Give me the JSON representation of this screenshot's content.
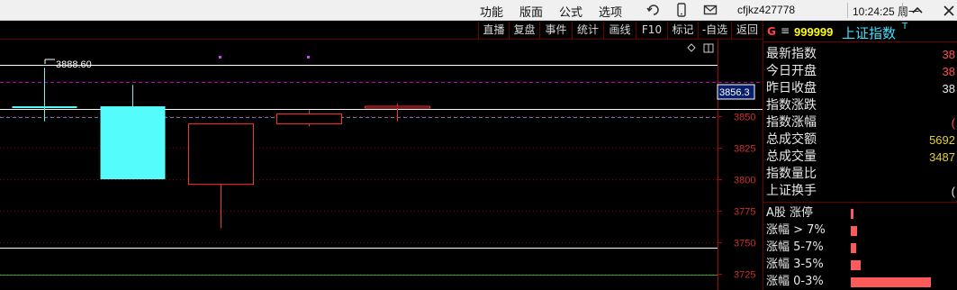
{
  "titlebar": {
    "menus": [
      "功能",
      "版面",
      "公式",
      "选项"
    ],
    "account": "cfjkz427778",
    "clock": "10:24:25 周一"
  },
  "toolbar": {
    "buttons": [
      "直播",
      "复盘",
      "事件",
      "统计",
      "画线",
      "F10",
      "标记",
      "-自选",
      "返回"
    ]
  },
  "chart": {
    "peak_label": "3888.60",
    "current_price_label": "3856.3",
    "ylim": [
      3712,
      3911
    ],
    "ticks": [
      "3850",
      "3825",
      "3800",
      "3775",
      "3750",
      "3725"
    ],
    "colors": {
      "up": "#ff3030",
      "down": "#54fcfc",
      "grid": "#8a0000",
      "axis": "#b00000"
    }
  },
  "chart_data": {
    "type": "candlestick",
    "ylim": [
      3712,
      3911
    ],
    "candles": [
      {
        "open": 3858,
        "close": 3858,
        "high": 3888.6,
        "low": 3846,
        "dir": "down"
      },
      {
        "open": 3858,
        "close": 3800,
        "high": 3875,
        "low": 3800,
        "dir": "down"
      },
      {
        "open": 3844,
        "close": 3796,
        "high": 3844,
        "low": 3761,
        "dir": "up"
      },
      {
        "open": 3844,
        "close": 3852,
        "high": 3855,
        "low": 3842,
        "dir": "up"
      },
      {
        "open": 3858,
        "close": 3858,
        "high": 3860,
        "low": 3846,
        "dir": "up"
      }
    ]
  },
  "panel": {
    "badge": "G",
    "menu_icon": "≡",
    "code": "999999",
    "name": "上证指数",
    "name_mark": "T",
    "stats": [
      {
        "label": "最新指数",
        "value": "38",
        "color": "red"
      },
      {
        "label": "今日开盘",
        "value": "38",
        "color": "red"
      },
      {
        "label": "昨日收盘",
        "value": "38",
        "color": "white"
      },
      {
        "label": "指数涨跌",
        "value": "",
        "color": "red"
      },
      {
        "label": "指数涨幅",
        "value": "(",
        "color": "red"
      },
      {
        "label": "总成交额",
        "value": "5692",
        "color": "yellow"
      },
      {
        "label": "总成交量",
        "value": "3487",
        "color": "yellow"
      },
      {
        "label": "指数量比",
        "value": "",
        "color": "white"
      },
      {
        "label": "上证换手",
        "value": "(",
        "color": "white"
      }
    ],
    "limits": [
      {
        "label": "A股 涨停",
        "level": 0.03
      },
      {
        "label": "涨幅 > 7%",
        "level": 0.07
      },
      {
        "label": "涨幅 5-7%",
        "level": 0.06
      },
      {
        "label": "涨幅 3-5%",
        "level": 0.12
      },
      {
        "label": "涨幅 0-3%",
        "level": 0.95
      }
    ]
  }
}
